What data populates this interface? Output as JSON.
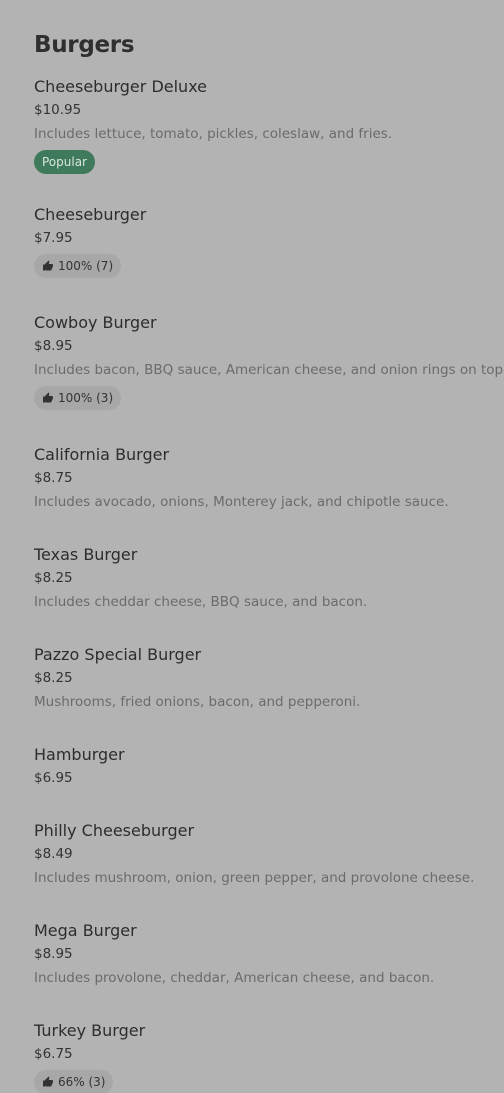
{
  "section": {
    "title": "Burgers"
  },
  "items": [
    {
      "name": "Cheeseburger Deluxe",
      "price": "$10.95",
      "description": "Includes lettuce, tomato, pickles, coleslaw, and fries.",
      "badge": "Popular"
    },
    {
      "name": "Cheeseburger",
      "price": "$7.95",
      "rating": "100% (7)"
    },
    {
      "name": "Cowboy Burger",
      "price": "$8.95",
      "description": "Includes bacon, BBQ sauce, American cheese, and onion rings on top.",
      "rating": "100% (3)"
    },
    {
      "name": "California Burger",
      "price": "$8.75",
      "description": "Includes avocado, onions, Monterey jack, and chipotle sauce."
    },
    {
      "name": "Texas Burger",
      "price": "$8.25",
      "description": "Includes cheddar cheese, BBQ sauce, and bacon."
    },
    {
      "name": "Pazzo Special Burger",
      "price": "$8.25",
      "description": "Mushrooms, fried onions, bacon, and pepperoni."
    },
    {
      "name": "Hamburger",
      "price": "$6.95"
    },
    {
      "name": "Philly Cheeseburger",
      "price": "$8.49",
      "description": "Includes mushroom, onion, green pepper, and provolone cheese."
    },
    {
      "name": "Mega Burger",
      "price": "$8.95",
      "description": "Includes provolone, cheddar, American cheese, and bacon."
    },
    {
      "name": "Turkey Burger",
      "price": "$6.75",
      "rating": "66% (3)"
    }
  ],
  "colors": {
    "background": "#b3b3b3",
    "popular_badge": "#3f7a5d",
    "rating_pill": "#a7a7a7"
  },
  "icons": {
    "rating": "thumbs-up-icon"
  }
}
